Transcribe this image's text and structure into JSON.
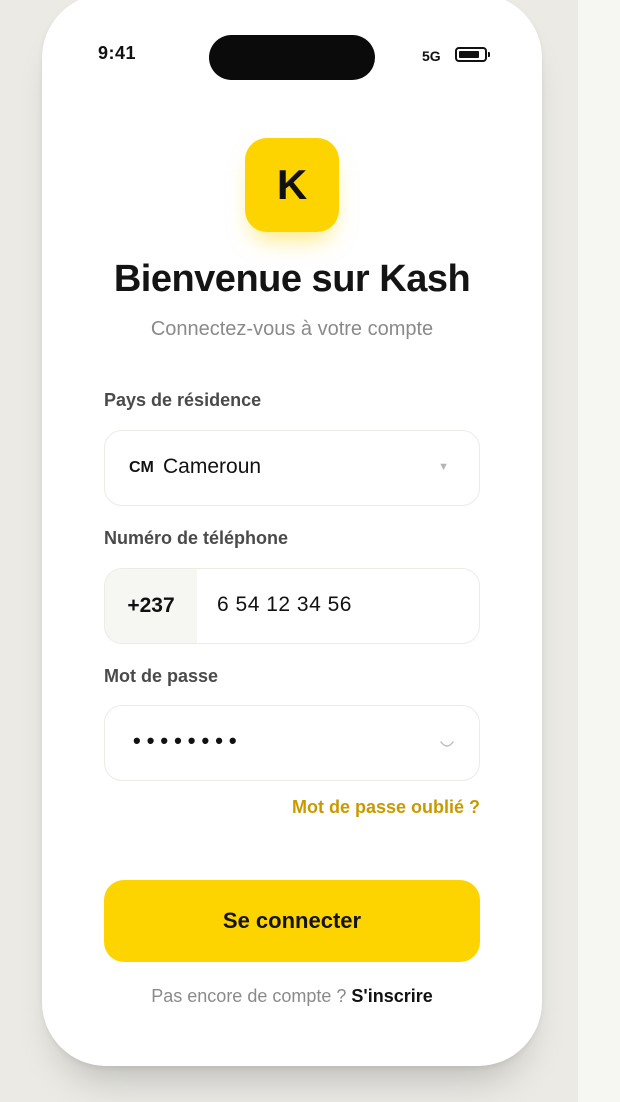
{
  "status_bar": {
    "time": "9:41",
    "network": "5G",
    "icons": [
      "battery-icon"
    ]
  },
  "logo": {
    "letter": "K",
    "color": "#fdd400"
  },
  "header": {
    "title": "Bienvenue sur Kash",
    "subtitle": "Connectez-vous à votre compte"
  },
  "form": {
    "country": {
      "label": "Pays de résidence",
      "code": "CM",
      "value": "Cameroun",
      "icon": "chevron-down-icon"
    },
    "phone": {
      "label": "Numéro de téléphone",
      "prefix": "+237",
      "value": "6 54 12 34 56"
    },
    "password": {
      "label": "Mot de passe",
      "value": "••••••••",
      "icon": "eye-icon"
    },
    "forgot_link": "Mot de passe oublié ?"
  },
  "actions": {
    "login_label": "Se connecter",
    "signup_prompt": "Pas encore de compte ?",
    "signup_link": "S'inscrire"
  },
  "colors": {
    "accent": "#fdd400",
    "link": "#c99a00",
    "text": "#141414",
    "muted": "#8a8a8a"
  }
}
